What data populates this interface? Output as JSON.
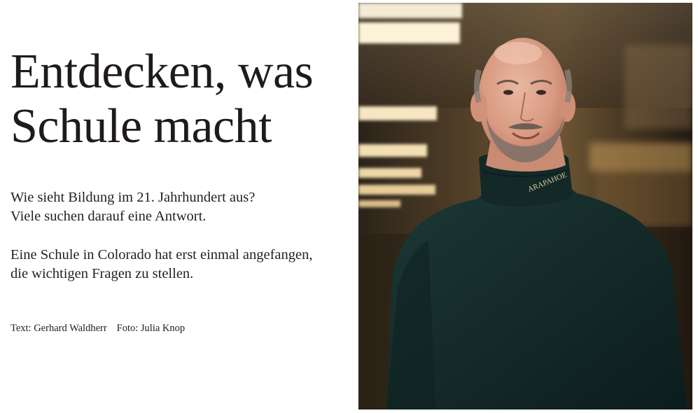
{
  "headline": {
    "line1": "Entdecken, was",
    "line2": "Schule macht"
  },
  "intro": {
    "line1": "Wie sieht Bildung im 21. Jahrhundert aus?",
    "line2": "Viele suchen darauf eine Antwort."
  },
  "body": {
    "line1": "Eine Schule in Colorado hat erst einmal angefangen,",
    "line2": "die wichtigen Fragen zu stellen."
  },
  "credits": {
    "text": "Text: Gerhard Waldherr",
    "photo": "Foto: Julia Knop"
  },
  "photo": {
    "collar_text": "ARAPAHOE"
  }
}
